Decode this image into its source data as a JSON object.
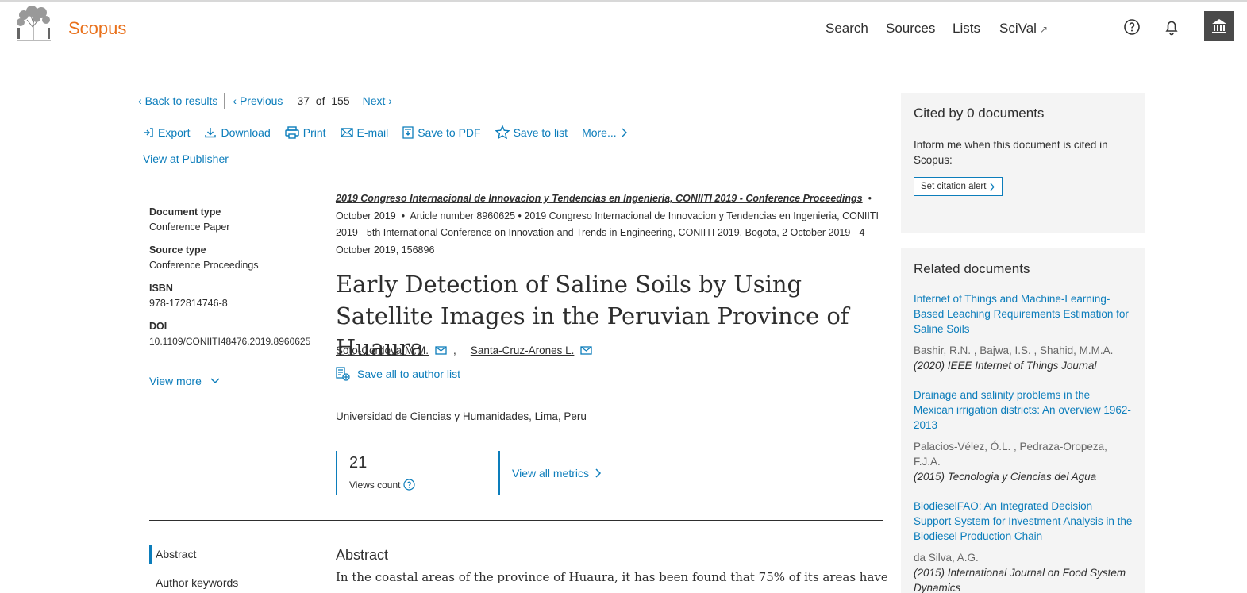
{
  "header": {
    "brand": "Scopus",
    "nav": [
      "Search",
      "Sources",
      "Lists",
      "SciVal"
    ],
    "nav_ext_icon": "↗",
    "icons": [
      "help-icon",
      "bell-icon",
      "institution-icon"
    ],
    "accent": "#e9711c",
    "link_color": "#0c7dbb"
  },
  "breadcrumb": {
    "back": "Back to results",
    "previous": "Previous",
    "current": "37",
    "of": "of",
    "total": "155",
    "next": "Next"
  },
  "actions": [
    "Export",
    "Download",
    "Print",
    "E-mail",
    "Save to PDF",
    "Save to list",
    "More..."
  ],
  "view_publisher": "View at Publisher",
  "info": {
    "doctype_label": "Document type",
    "doctype": "Conference Paper",
    "srctype_label": "Source type",
    "srctype": "Conference Proceedings",
    "isbn_label": "ISBN",
    "isbn": "978-172814746-8",
    "doi_label": "DOI",
    "doi": "10.1109/CONIITI48476.2019.8960625",
    "view_more": "View more"
  },
  "source": {
    "name": "2019 Congreso Internacional de Innovacion y Tendencias en Ingenieria, CONIITI 2019 - Conference Proceedings",
    "date": "October 2019",
    "rest": "Article number 8960625  •  2019 Congreso Internacional de Innovacion y Tendencias en Ingenieria, CONIITI 2019 - 5th International Conference on Innovation and Trends in Engineering, CONIITI 2019, Bogota, 2 October 2019 - 4 October 2019, 156896"
  },
  "article": {
    "title": "Early Detection of Saline Soils by Using Satellite Images in the Peruvian Province of Huaura",
    "authors": [
      "Soto-Cordova M.M.",
      "Santa-Cruz-Arones L."
    ],
    "save_authors": "Save all to author list",
    "affiliation": "Universidad de Ciencias y Humanidades, Lima, Peru"
  },
  "metrics": {
    "views": "21",
    "views_label": "Views count",
    "view_all": "View all metrics"
  },
  "toc": [
    "Abstract",
    "Author keywords"
  ],
  "abstract": {
    "heading": "Abstract",
    "text": "In the coastal areas of the province of Huaura, it has been found that 75% of its areas have"
  },
  "cited": {
    "heading": "Cited by 0 documents",
    "inform": "Inform me when this document is cited in Scopus:",
    "alert_button": "Set citation alert"
  },
  "related": {
    "heading": "Related documents",
    "items": [
      {
        "title": "Internet of Things and Machine-Learning-Based Leaching Requirements Estimation for Saline Soils",
        "authors": "Bashir, R.N. , Bajwa, I.S. , Shahid, M.M.A.",
        "journal": "(2020) IEEE Internet of Things Journal"
      },
      {
        "title": "Drainage and salinity problems in the Mexican irrigation districts: An overview 1962-2013",
        "authors": "Palacios-Vélez, Ó.L. , Pedraza-Oropeza, F.J.A.",
        "journal": "(2015) Tecnologia y Ciencias del Agua"
      },
      {
        "title": "BiodieselFAO: An Integrated Decision Support System for Investment Analysis in the Biodiesel Production Chain",
        "authors": "da Silva, A.G.",
        "journal": "(2015) International Journal on Food System Dynamics"
      }
    ]
  }
}
